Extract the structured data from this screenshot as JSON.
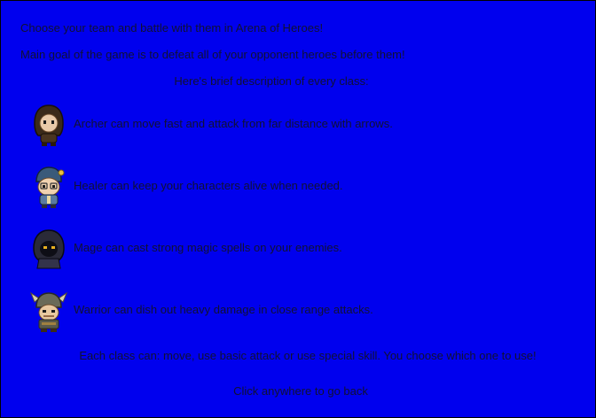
{
  "intro": {
    "line1": "Choose your team and battle with them in Arena of Heroes!",
    "line2": "Main goal of the game is to defeat all of your opponent heroes before them!",
    "brief": "Here's brief description of every class:"
  },
  "classes": [
    {
      "name": "archer",
      "icon": "archer-portrait-icon",
      "text": "Archer can move fast and attack from far distance with arrows."
    },
    {
      "name": "healer",
      "icon": "healer-portrait-icon",
      "text": "Healer can keep your characters alive when needed."
    },
    {
      "name": "mage",
      "icon": "mage-portrait-icon",
      "text": "Mage can cast strong magic spells on your enemies."
    },
    {
      "name": "warrior",
      "icon": "warrior-portrait-icon",
      "text": "Warrior can dish out heavy damage in close range attacks."
    }
  ],
  "closing": "Each  class can: move, use basic attack or use special skill. You choose which one to use!",
  "back_prompt": "Click anywhere to go back",
  "colors": {
    "background": "#0000ee",
    "text": "#111133",
    "frame": "#000000"
  }
}
